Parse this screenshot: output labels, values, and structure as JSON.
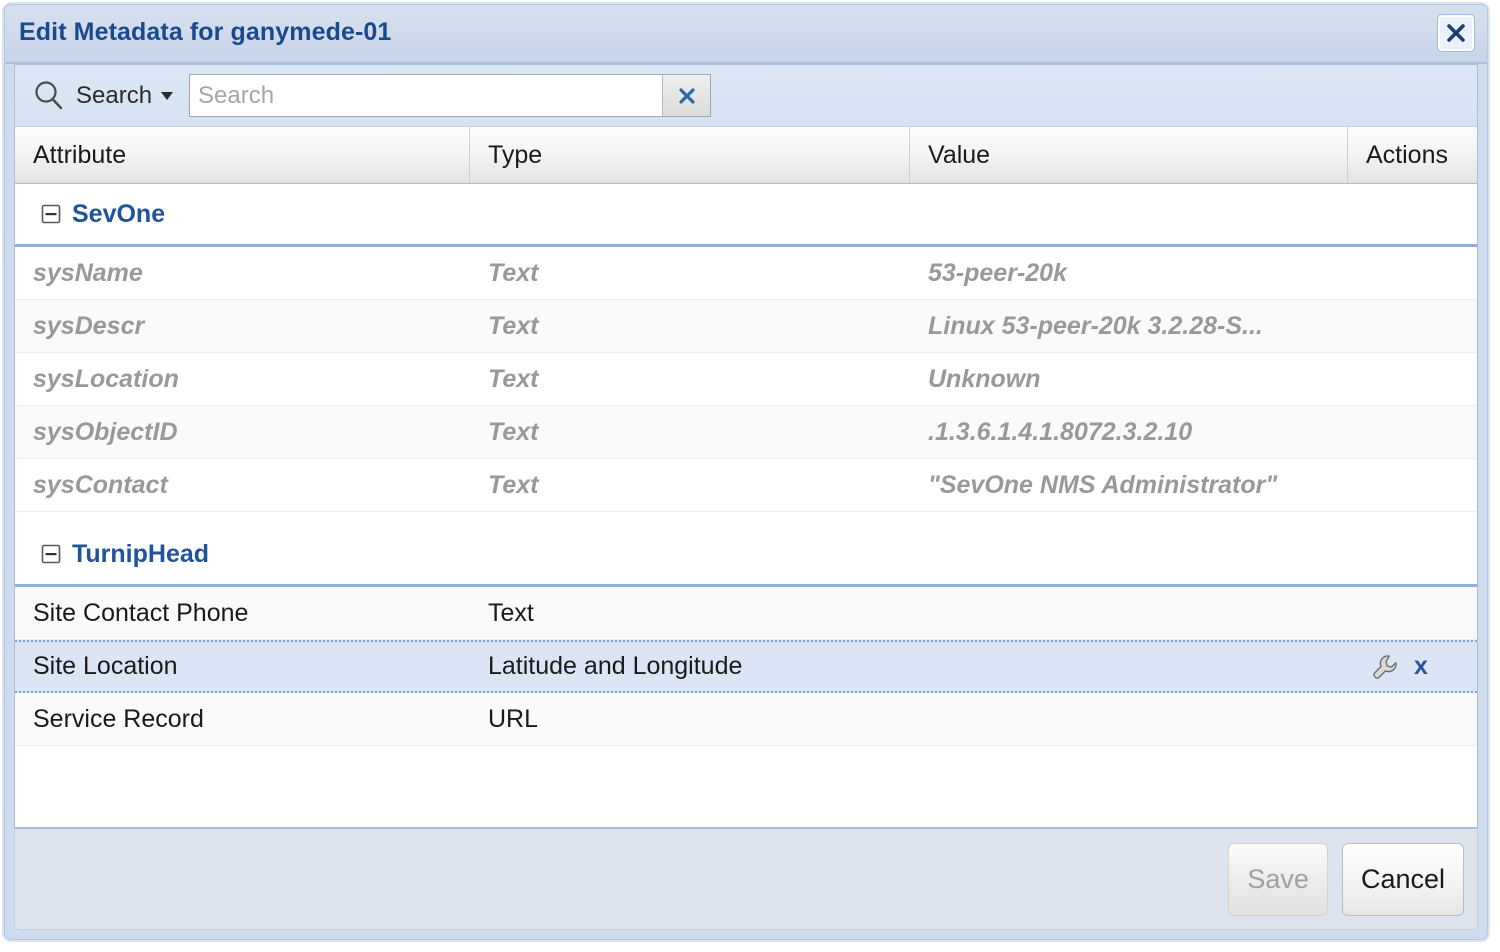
{
  "window": {
    "title": "Edit Metadata for ganymede-01",
    "close_icon": "close-icon"
  },
  "toolbar": {
    "search_icon": "search-icon",
    "search_menu_label": "Search",
    "search_menu_caret": "chevron-down-icon",
    "search_value": "",
    "search_placeholder": "Search",
    "clear_icon": "clear-icon"
  },
  "grid": {
    "columns": [
      {
        "key": "attribute",
        "label": "Attribute"
      },
      {
        "key": "type",
        "label": "Type"
      },
      {
        "key": "value",
        "label": "Value"
      },
      {
        "key": "actions",
        "label": "Actions"
      }
    ],
    "groups": [
      {
        "name": "SevOne",
        "toggle_icon": "collapse-minus-icon",
        "readonly": true,
        "rows": [
          {
            "attribute": "sysName",
            "type": "Text",
            "value": "53-peer-20k",
            "actions": []
          },
          {
            "attribute": "sysDescr",
            "type": "Text",
            "value": "Linux 53-peer-20k 3.2.28-S...",
            "actions": []
          },
          {
            "attribute": "sysLocation",
            "type": "Text",
            "value": "Unknown",
            "actions": []
          },
          {
            "attribute": "sysObjectID",
            "type": "Text",
            "value": ".1.3.6.1.4.1.8072.3.2.10",
            "actions": []
          },
          {
            "attribute": "sysContact",
            "type": "Text",
            "value": "\"SevOne NMS Administrator\"",
            "actions": []
          }
        ]
      },
      {
        "name": "TurnipHead",
        "toggle_icon": "collapse-minus-icon",
        "readonly": false,
        "rows": [
          {
            "attribute": "Site Contact Phone",
            "type": "Text",
            "value": "",
            "actions": [],
            "selected": false
          },
          {
            "attribute": "Site Location",
            "type": "Latitude and Longitude",
            "value": "",
            "actions": [
              "wrench-icon",
              "delete-x-icon"
            ],
            "selected": true
          },
          {
            "attribute": "Service Record",
            "type": "URL",
            "value": "",
            "actions": [],
            "selected": false
          }
        ]
      }
    ]
  },
  "footer": {
    "save_label": "Save",
    "save_disabled": true,
    "cancel_label": "Cancel"
  },
  "colors": {
    "title_text": "#1a4a8e",
    "group_label": "#20539b",
    "selected_row_bg": "#dbe5f5",
    "selected_row_border": "#7ea4d4",
    "readonly_text": "#999999",
    "toolbar_bg": "#d9e4f2",
    "footer_bg": "#dde4ee",
    "action_icon": "#2c5699"
  }
}
